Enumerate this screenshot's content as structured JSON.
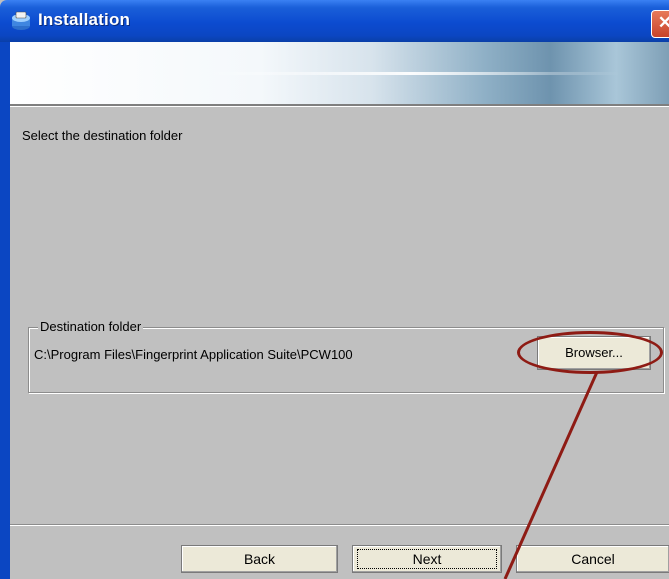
{
  "window": {
    "title": "Installation",
    "close_symbol": "✕"
  },
  "page": {
    "prompt": "Select the destination folder"
  },
  "destination": {
    "legend": "Destination folder",
    "path": "C:\\Program Files\\Fingerprint Application Suite\\PCW100",
    "browse_label": "Browser..."
  },
  "buttons": {
    "back": "Back",
    "next": "Next",
    "cancel": "Cancel"
  },
  "icons": {
    "title": "installer-icon",
    "close": "close-icon"
  },
  "colors": {
    "titlebar": "#0b46c2",
    "dialog_bg": "#c0c0c0",
    "annotation": "#8e1b14"
  }
}
